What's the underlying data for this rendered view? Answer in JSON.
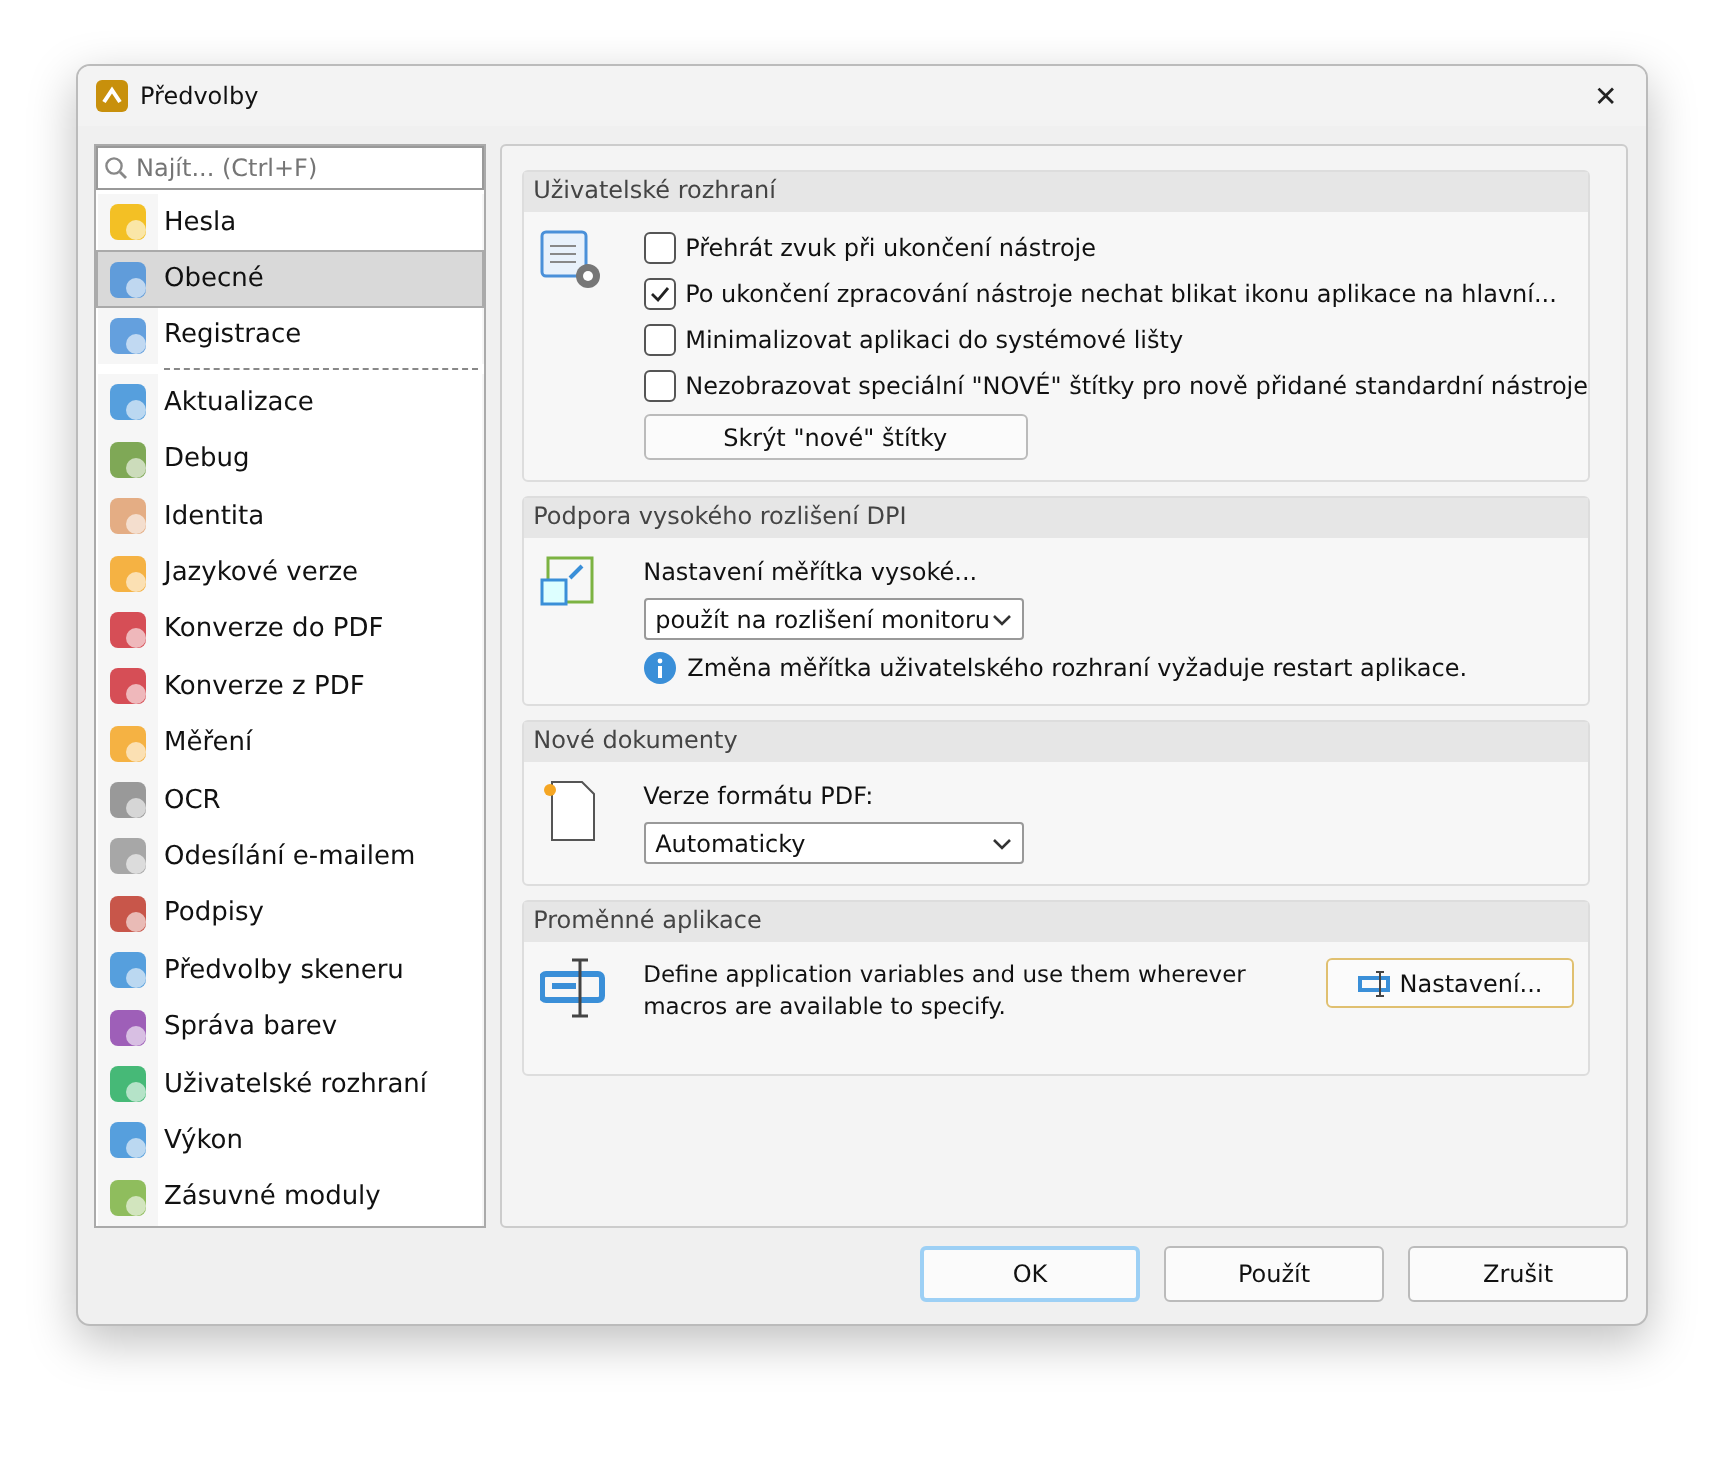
{
  "window": {
    "title": "Předvolby",
    "close": "✕"
  },
  "sidebar": {
    "search": {
      "placeholder": "Najít... (Ctrl+F)"
    },
    "items": [
      {
        "label": "Hesla",
        "selected": false,
        "separator_after": false
      },
      {
        "label": "Obecné",
        "selected": true,
        "separator_after": false
      },
      {
        "label": "Registrace",
        "selected": false,
        "separator_after": true
      },
      {
        "label": "Aktualizace",
        "selected": false,
        "separator_after": false
      },
      {
        "label": "Debug",
        "selected": false,
        "separator_after": false
      },
      {
        "label": "Identita",
        "selected": false,
        "separator_after": false
      },
      {
        "label": "Jazykové verze",
        "selected": false,
        "separator_after": false
      },
      {
        "label": "Konverze do PDF",
        "selected": false,
        "separator_after": false
      },
      {
        "label": "Konverze z PDF",
        "selected": false,
        "separator_after": false
      },
      {
        "label": "Měření",
        "selected": false,
        "separator_after": false
      },
      {
        "label": "OCR",
        "selected": false,
        "separator_after": false
      },
      {
        "label": "Odesílání e-mailem",
        "selected": false,
        "separator_after": false
      },
      {
        "label": "Podpisy",
        "selected": false,
        "separator_after": false
      },
      {
        "label": "Předvolby skeneru",
        "selected": false,
        "separator_after": false
      },
      {
        "label": "Správa barev",
        "selected": false,
        "separator_after": false
      },
      {
        "label": "Uživatelské rozhraní",
        "selected": false,
        "separator_after": false
      },
      {
        "label": "Výkon",
        "selected": false,
        "separator_after": false
      },
      {
        "label": "Zásuvné moduly",
        "selected": false,
        "separator_after": false
      }
    ]
  },
  "sections": [
    {
      "kind": "checkboxes",
      "title": "Uživatelské rozhraní",
      "options": [
        {
          "label": "Přehrát zvuk při ukončení nástroje",
          "checked": false
        },
        {
          "label": "Po ukončení zpracování nástroje nechat blikat ikonu aplikace na hlavní...",
          "checked": true
        },
        {
          "label": "Minimalizovat aplikaci do systémové lišty",
          "checked": false
        },
        {
          "label": "Nezobrazovat speciální \"NOVÉ\" štítky pro nově přidané standardní nástroje",
          "checked": false
        }
      ],
      "button": "Skrýt \"nové\" štítky"
    },
    {
      "kind": "dropdown",
      "title": "Podpora vysokého rozlišení DPI",
      "label": "Nastavení měřítka vysoké...",
      "value": "použít na rozlišení monitoru",
      "note": "Změna měřítka uživatelského rozhraní vyžaduje restart aplikace."
    },
    {
      "kind": "dropdown",
      "title": "Nové dokumenty",
      "label": "Verze formátu PDF:",
      "value": "Automaticky"
    },
    {
      "kind": "variables",
      "title": "Proměnné aplikace",
      "text": "Define application variables and use them wherever macros are available to specify.",
      "button": "Nastavení..."
    }
  ],
  "buttons": [
    {
      "label": "OK",
      "default": true
    },
    {
      "label": "Použít",
      "default": false
    },
    {
      "label": "Zrušit",
      "default": false
    }
  ]
}
